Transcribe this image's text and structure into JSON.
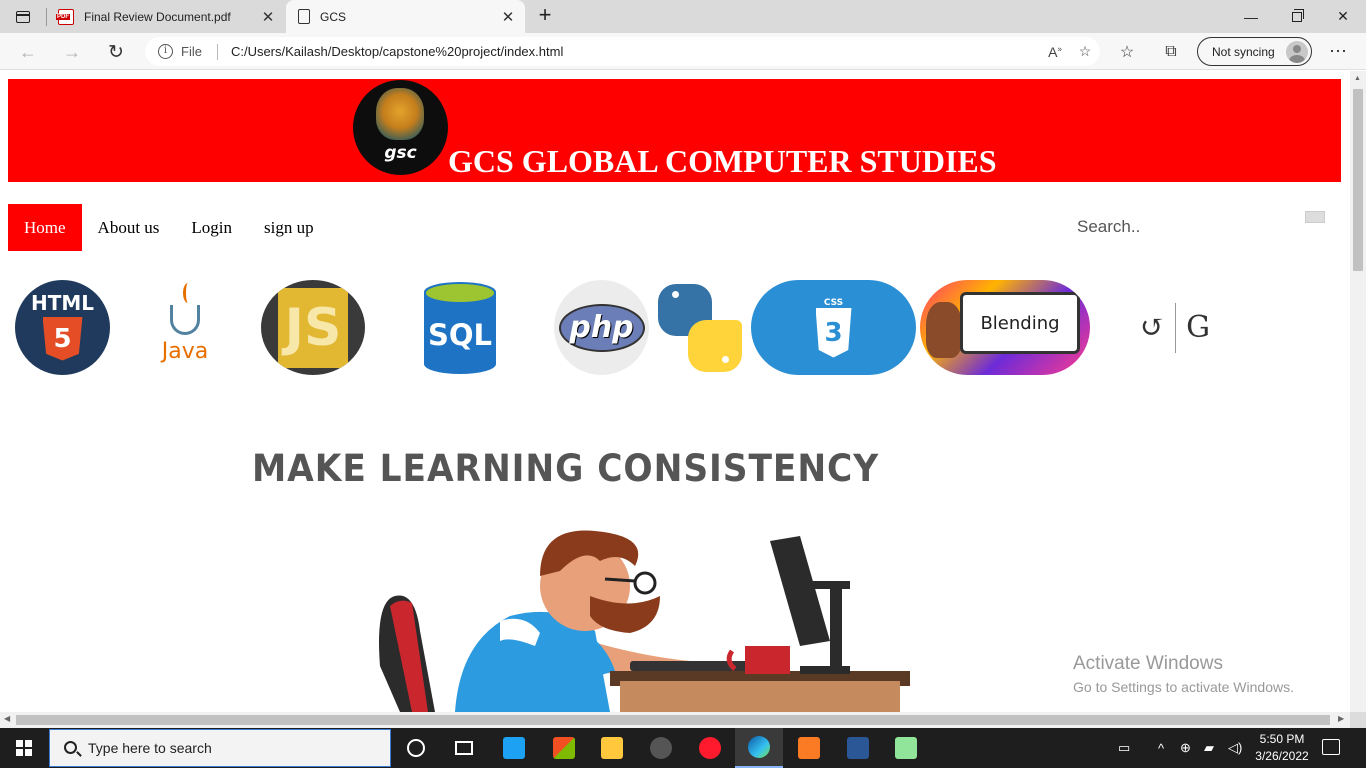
{
  "browser": {
    "tabs": [
      {
        "title": "Final Review Document.pdf",
        "icon": "pdf-icon",
        "active": false
      },
      {
        "title": "GCS",
        "icon": "page-icon",
        "active": true
      }
    ],
    "address": {
      "file_label": "File",
      "url": "C:/Users/Kailash/Desktop/capstone%20project/index.html"
    },
    "sync_label": "Not syncing"
  },
  "page": {
    "logo_text": "gsc",
    "site_title": "GCS GLOBAL COMPUTER STUDIES",
    "header_color": "#ff0000",
    "menu": [
      {
        "label": "Home",
        "active": true
      },
      {
        "label": "About us",
        "active": false
      },
      {
        "label": "Login",
        "active": false
      },
      {
        "label": "sign up",
        "active": false
      }
    ],
    "search_placeholder": "Search..",
    "tech_icons": [
      {
        "name": "html5-logo",
        "text": "HTML",
        "mark": "5"
      },
      {
        "name": "java-logo",
        "text": "Java"
      },
      {
        "name": "javascript-logo",
        "mark": "JS"
      },
      {
        "name": "sql-logo",
        "text": "SQL"
      },
      {
        "name": "php-logo",
        "text": "php"
      },
      {
        "name": "python-logo"
      },
      {
        "name": "css3-logo",
        "text": "CSS",
        "mark": "3"
      },
      {
        "name": "blending-logo",
        "text": "Blending"
      },
      {
        "name": "gc-logo",
        "text": "G"
      }
    ],
    "slogan": "MAKE LEARNING CONSISTENCY",
    "watermark": {
      "line1": "Activate Windows",
      "line2": "Go to Settings to activate Windows."
    }
  },
  "taskbar": {
    "search_placeholder": "Type here to search",
    "time": "5:50 PM",
    "date": "3/26/2022"
  }
}
